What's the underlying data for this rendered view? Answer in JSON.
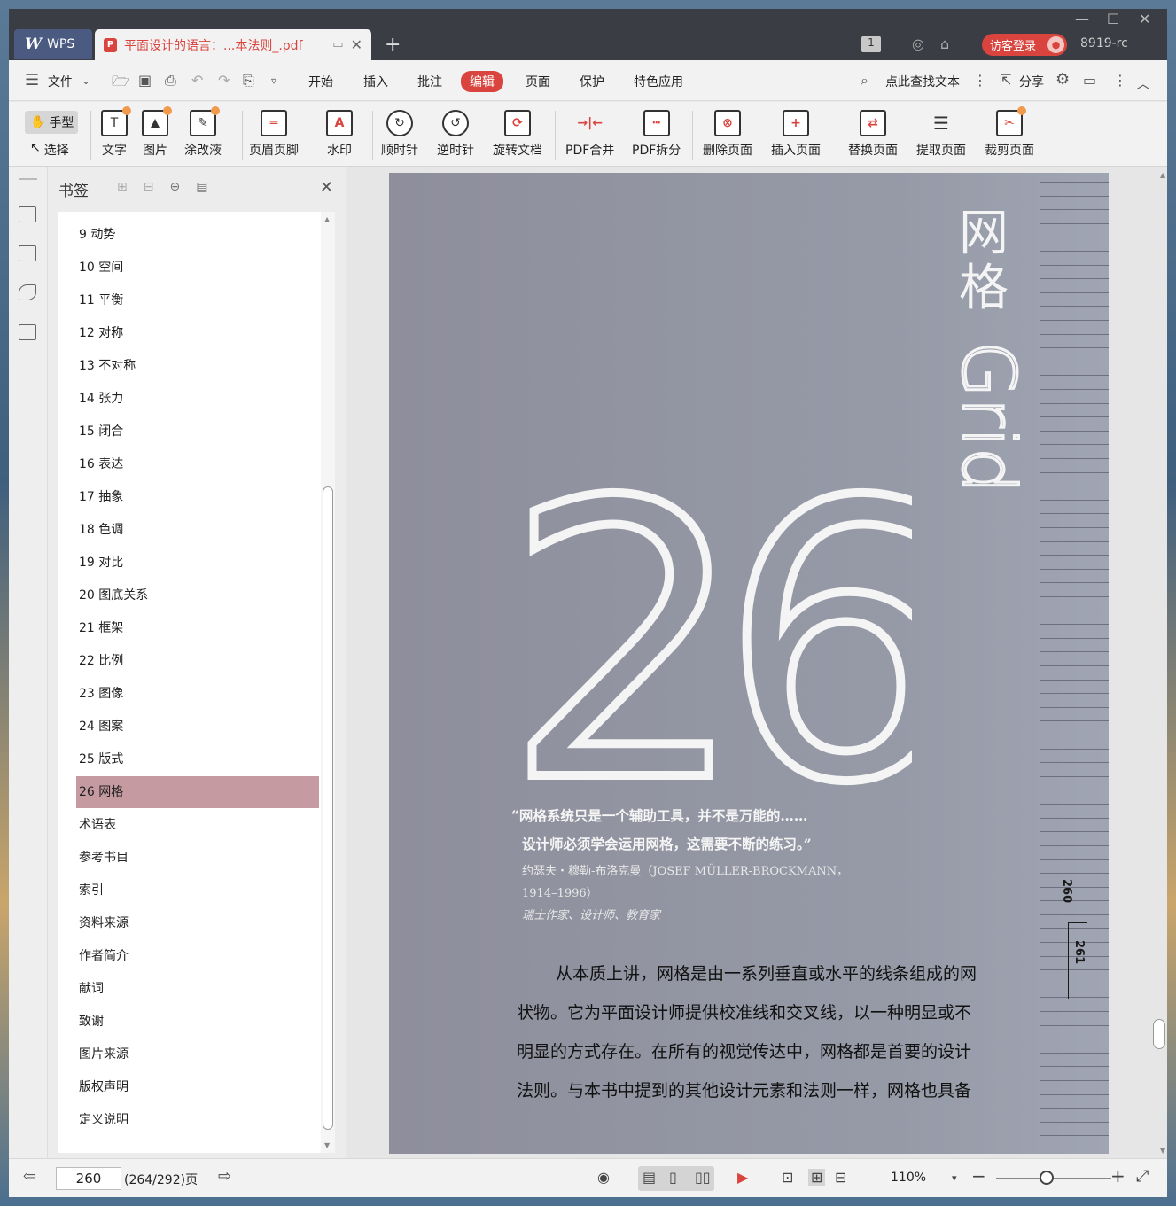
{
  "titlebar": {
    "app_name": "WPS",
    "doc_tab_title": "平面设计的语言：...本法则_.pdf",
    "new_tab": "+",
    "badge": "1",
    "login_label": "访客登录",
    "user_id": "8919-rc"
  },
  "menubar": {
    "file_label": "文件",
    "items": [
      "开始",
      "插入",
      "批注",
      "编辑",
      "页面",
      "保护",
      "特色应用"
    ],
    "active": "编辑",
    "search_label": "点此查找文本",
    "share_label": "分享"
  },
  "ribbon": {
    "hand_label": "手型",
    "select_label": "选择",
    "buttons": [
      "文字",
      "图片",
      "涂改液",
      "页眉页脚",
      "水印",
      "顺时针",
      "逆时针",
      "旋转文档",
      "PDF合并",
      "PDF拆分",
      "删除页面",
      "插入页面",
      "替换页面",
      "提取页面",
      "裁剪页面"
    ]
  },
  "bookmarks": {
    "title": "书签",
    "items": [
      "9 动势",
      "10 空间",
      "11 平衡",
      "12 对称",
      "13 不对称",
      "14 张力",
      "15 闭合",
      "16 表达",
      "17 抽象",
      "18 色调",
      "19 对比",
      "20 图底关系",
      "21 框架",
      "22 比例",
      "23 图像",
      "24 图案",
      "25 版式",
      "26 网格",
      "术语表",
      "参考书目",
      "索引",
      "资料来源",
      "作者简介",
      "献词",
      "致谢",
      "图片来源",
      "版权声明",
      "定义说明"
    ],
    "selected": "26 网格"
  },
  "page": {
    "title_cn_1": "网",
    "title_cn_2": "格",
    "title_en": "Grid",
    "chapter_number": "26",
    "quote_line1": "“网格系统只是一个辅助工具，并不是万能的……",
    "quote_line2": "设计师必须学会运用网格，这需要不断的练习。”",
    "author_line1": "约瑟夫・穆勒-布洛克曼（JOSEF MÜLLER-BROCKMANN，",
    "author_line2": "1914–1996）",
    "author_line3": "瑞士作家、设计师、教育家",
    "page_num_left": "260",
    "page_num_right": "261",
    "body_lines": [
      "从本质上讲，网格是由一系列垂直或水平的线条组成的网",
      "状物。它为平面设计师提供校准线和交叉线，以一种明显或不",
      "明显的方式存在。在所有的视觉传达中，网格都是首要的设计",
      "法则。与本书中提到的其他设计元素和法则一样，网格也具备"
    ]
  },
  "statusbar": {
    "current_page": "260",
    "total": "(264/292)页",
    "zoom": "110%"
  },
  "colors": {
    "accent": "#d9453e",
    "bookmark_selected": "#c59aa0",
    "page_bg": "#969aa7"
  }
}
